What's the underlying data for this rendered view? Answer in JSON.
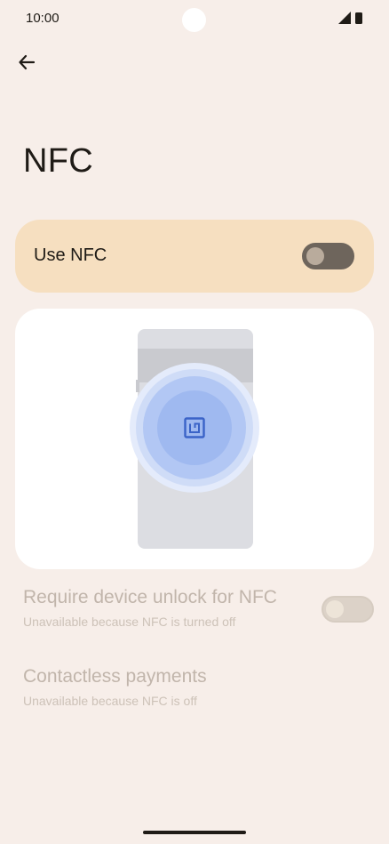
{
  "status_bar": {
    "time": "10:00"
  },
  "page": {
    "title": "NFC"
  },
  "main_switch": {
    "label": "Use NFC",
    "checked": false
  },
  "preferences": [
    {
      "title": "Require device unlock for NFC",
      "summary": "Unavailable because NFC is turned off",
      "has_toggle": true,
      "enabled": false
    },
    {
      "title": "Contactless payments",
      "summary": "Unavailable because NFC is off",
      "has_toggle": false,
      "enabled": false
    }
  ],
  "colors": {
    "background": "#f7eee9",
    "main_switch_card": "#f6dfc0",
    "nfc_accent": "#4b78d8"
  },
  "icons": {
    "back": "arrow-back-icon",
    "signal": "cellular-signal-icon",
    "battery": "battery-icon",
    "nfc": "nfc-icon"
  }
}
